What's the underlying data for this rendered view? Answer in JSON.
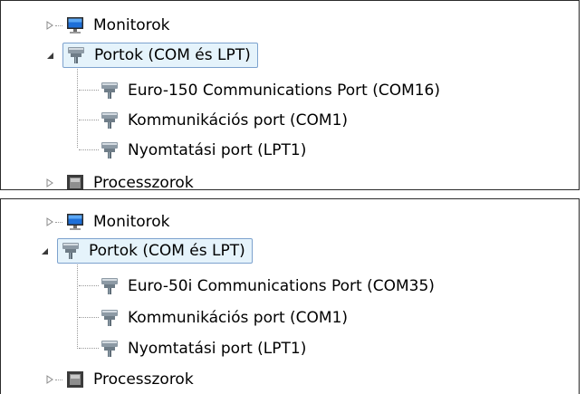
{
  "panels": [
    {
      "monitors_label": "Monitorok",
      "ports_label": "Portok (COM és LPT)",
      "children": [
        {
          "label": "Euro-150 Communications Port (COM16)"
        },
        {
          "label": "Kommunikációs port (COM1)"
        },
        {
          "label": "Nyomtatási port (LPT1)"
        }
      ],
      "processors_label": "Processzorok"
    },
    {
      "monitors_label": "Monitorok",
      "ports_label": "Portok (COM és LPT)",
      "children": [
        {
          "label": "Euro-50i Communications Port (COM35)"
        },
        {
          "label": "Kommunikációs port (COM1)"
        },
        {
          "label": "Nyomtatási port (LPT1)"
        }
      ],
      "processors_label": "Processzorok"
    }
  ],
  "icons": {
    "collapsed_expander": "triangle-right-outline-icon",
    "expanded_expander": "triangle-down-filled-icon",
    "monitor": "monitor-icon",
    "port": "port-connector-icon",
    "processor": "processor-chip-icon"
  }
}
